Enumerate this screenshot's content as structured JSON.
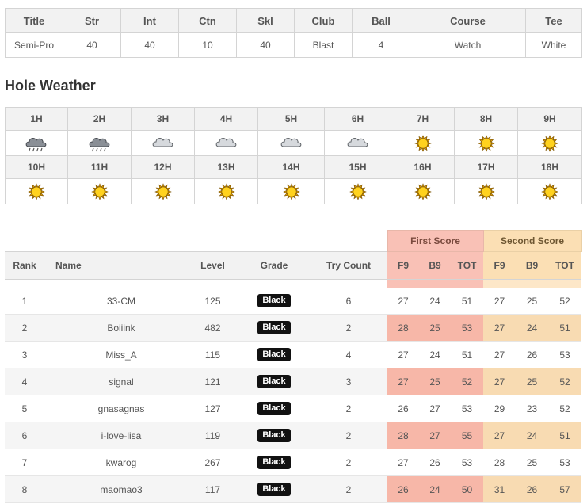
{
  "stats": {
    "headers": [
      "Title",
      "Str",
      "Int",
      "Ctn",
      "Skl",
      "Club",
      "Ball",
      "Course",
      "Tee"
    ],
    "values": [
      "Semi-Pro",
      "40",
      "40",
      "10",
      "40",
      "Blast",
      "4",
      "Watch",
      "White"
    ]
  },
  "weather": {
    "title": "Hole Weather",
    "holes": [
      {
        "label": "1H",
        "icon": "rain-cloud-icon"
      },
      {
        "label": "2H",
        "icon": "rain-cloud-icon"
      },
      {
        "label": "3H",
        "icon": "cloud-icon"
      },
      {
        "label": "4H",
        "icon": "cloud-icon"
      },
      {
        "label": "5H",
        "icon": "cloud-icon"
      },
      {
        "label": "6H",
        "icon": "cloud-icon"
      },
      {
        "label": "7H",
        "icon": "sun-icon"
      },
      {
        "label": "8H",
        "icon": "sun-icon"
      },
      {
        "label": "9H",
        "icon": "sun-icon"
      },
      {
        "label": "10H",
        "icon": "sun-icon"
      },
      {
        "label": "11H",
        "icon": "sun-icon"
      },
      {
        "label": "12H",
        "icon": "sun-icon"
      },
      {
        "label": "13H",
        "icon": "sun-icon"
      },
      {
        "label": "14H",
        "icon": "sun-icon"
      },
      {
        "label": "15H",
        "icon": "sun-icon"
      },
      {
        "label": "16H",
        "icon": "sun-icon"
      },
      {
        "label": "17H",
        "icon": "sun-icon"
      },
      {
        "label": "18H",
        "icon": "sun-icon"
      }
    ]
  },
  "ranking": {
    "groups": {
      "first": "First Score",
      "second": "Second Score"
    },
    "headers": {
      "rank": "Rank",
      "name": "Name",
      "level": "Level",
      "grade": "Grade",
      "try_count": "Try Count",
      "f9": "F9",
      "b9": "B9",
      "tot": "TOT",
      "f9b": "F9",
      "b9b": "B9",
      "totb": "TOT"
    },
    "rows": [
      {
        "rank": "1",
        "name": "33-CM",
        "level": "125",
        "grade": "Black",
        "try": "6",
        "f9": "27",
        "b9": "24",
        "tot": "51",
        "f9b": "27",
        "b9b": "25",
        "totb": "52"
      },
      {
        "rank": "2",
        "name": "Boiiink",
        "level": "482",
        "grade": "Black",
        "try": "2",
        "f9": "28",
        "b9": "25",
        "tot": "53",
        "f9b": "27",
        "b9b": "24",
        "totb": "51"
      },
      {
        "rank": "3",
        "name": "Miss_A",
        "level": "115",
        "grade": "Black",
        "try": "4",
        "f9": "27",
        "b9": "24",
        "tot": "51",
        "f9b": "27",
        "b9b": "26",
        "totb": "53"
      },
      {
        "rank": "4",
        "name": "signal",
        "level": "121",
        "grade": "Black",
        "try": "3",
        "f9": "27",
        "b9": "25",
        "tot": "52",
        "f9b": "27",
        "b9b": "25",
        "totb": "52"
      },
      {
        "rank": "5",
        "name": "gnasagnas",
        "level": "127",
        "grade": "Black",
        "try": "2",
        "f9": "26",
        "b9": "27",
        "tot": "53",
        "f9b": "29",
        "b9b": "23",
        "totb": "52"
      },
      {
        "rank": "6",
        "name": "i-love-lisa",
        "level": "119",
        "grade": "Black",
        "try": "2",
        "f9": "28",
        "b9": "27",
        "tot": "55",
        "f9b": "27",
        "b9b": "24",
        "totb": "51"
      },
      {
        "rank": "7",
        "name": "kwarog",
        "level": "267",
        "grade": "Black",
        "try": "2",
        "f9": "27",
        "b9": "26",
        "tot": "53",
        "f9b": "28",
        "b9b": "25",
        "totb": "53"
      },
      {
        "rank": "8",
        "name": "maomao3",
        "level": "117",
        "grade": "Black",
        "try": "2",
        "f9": "26",
        "b9": "24",
        "tot": "50",
        "f9b": "31",
        "b9b": "26",
        "totb": "57"
      }
    ]
  }
}
